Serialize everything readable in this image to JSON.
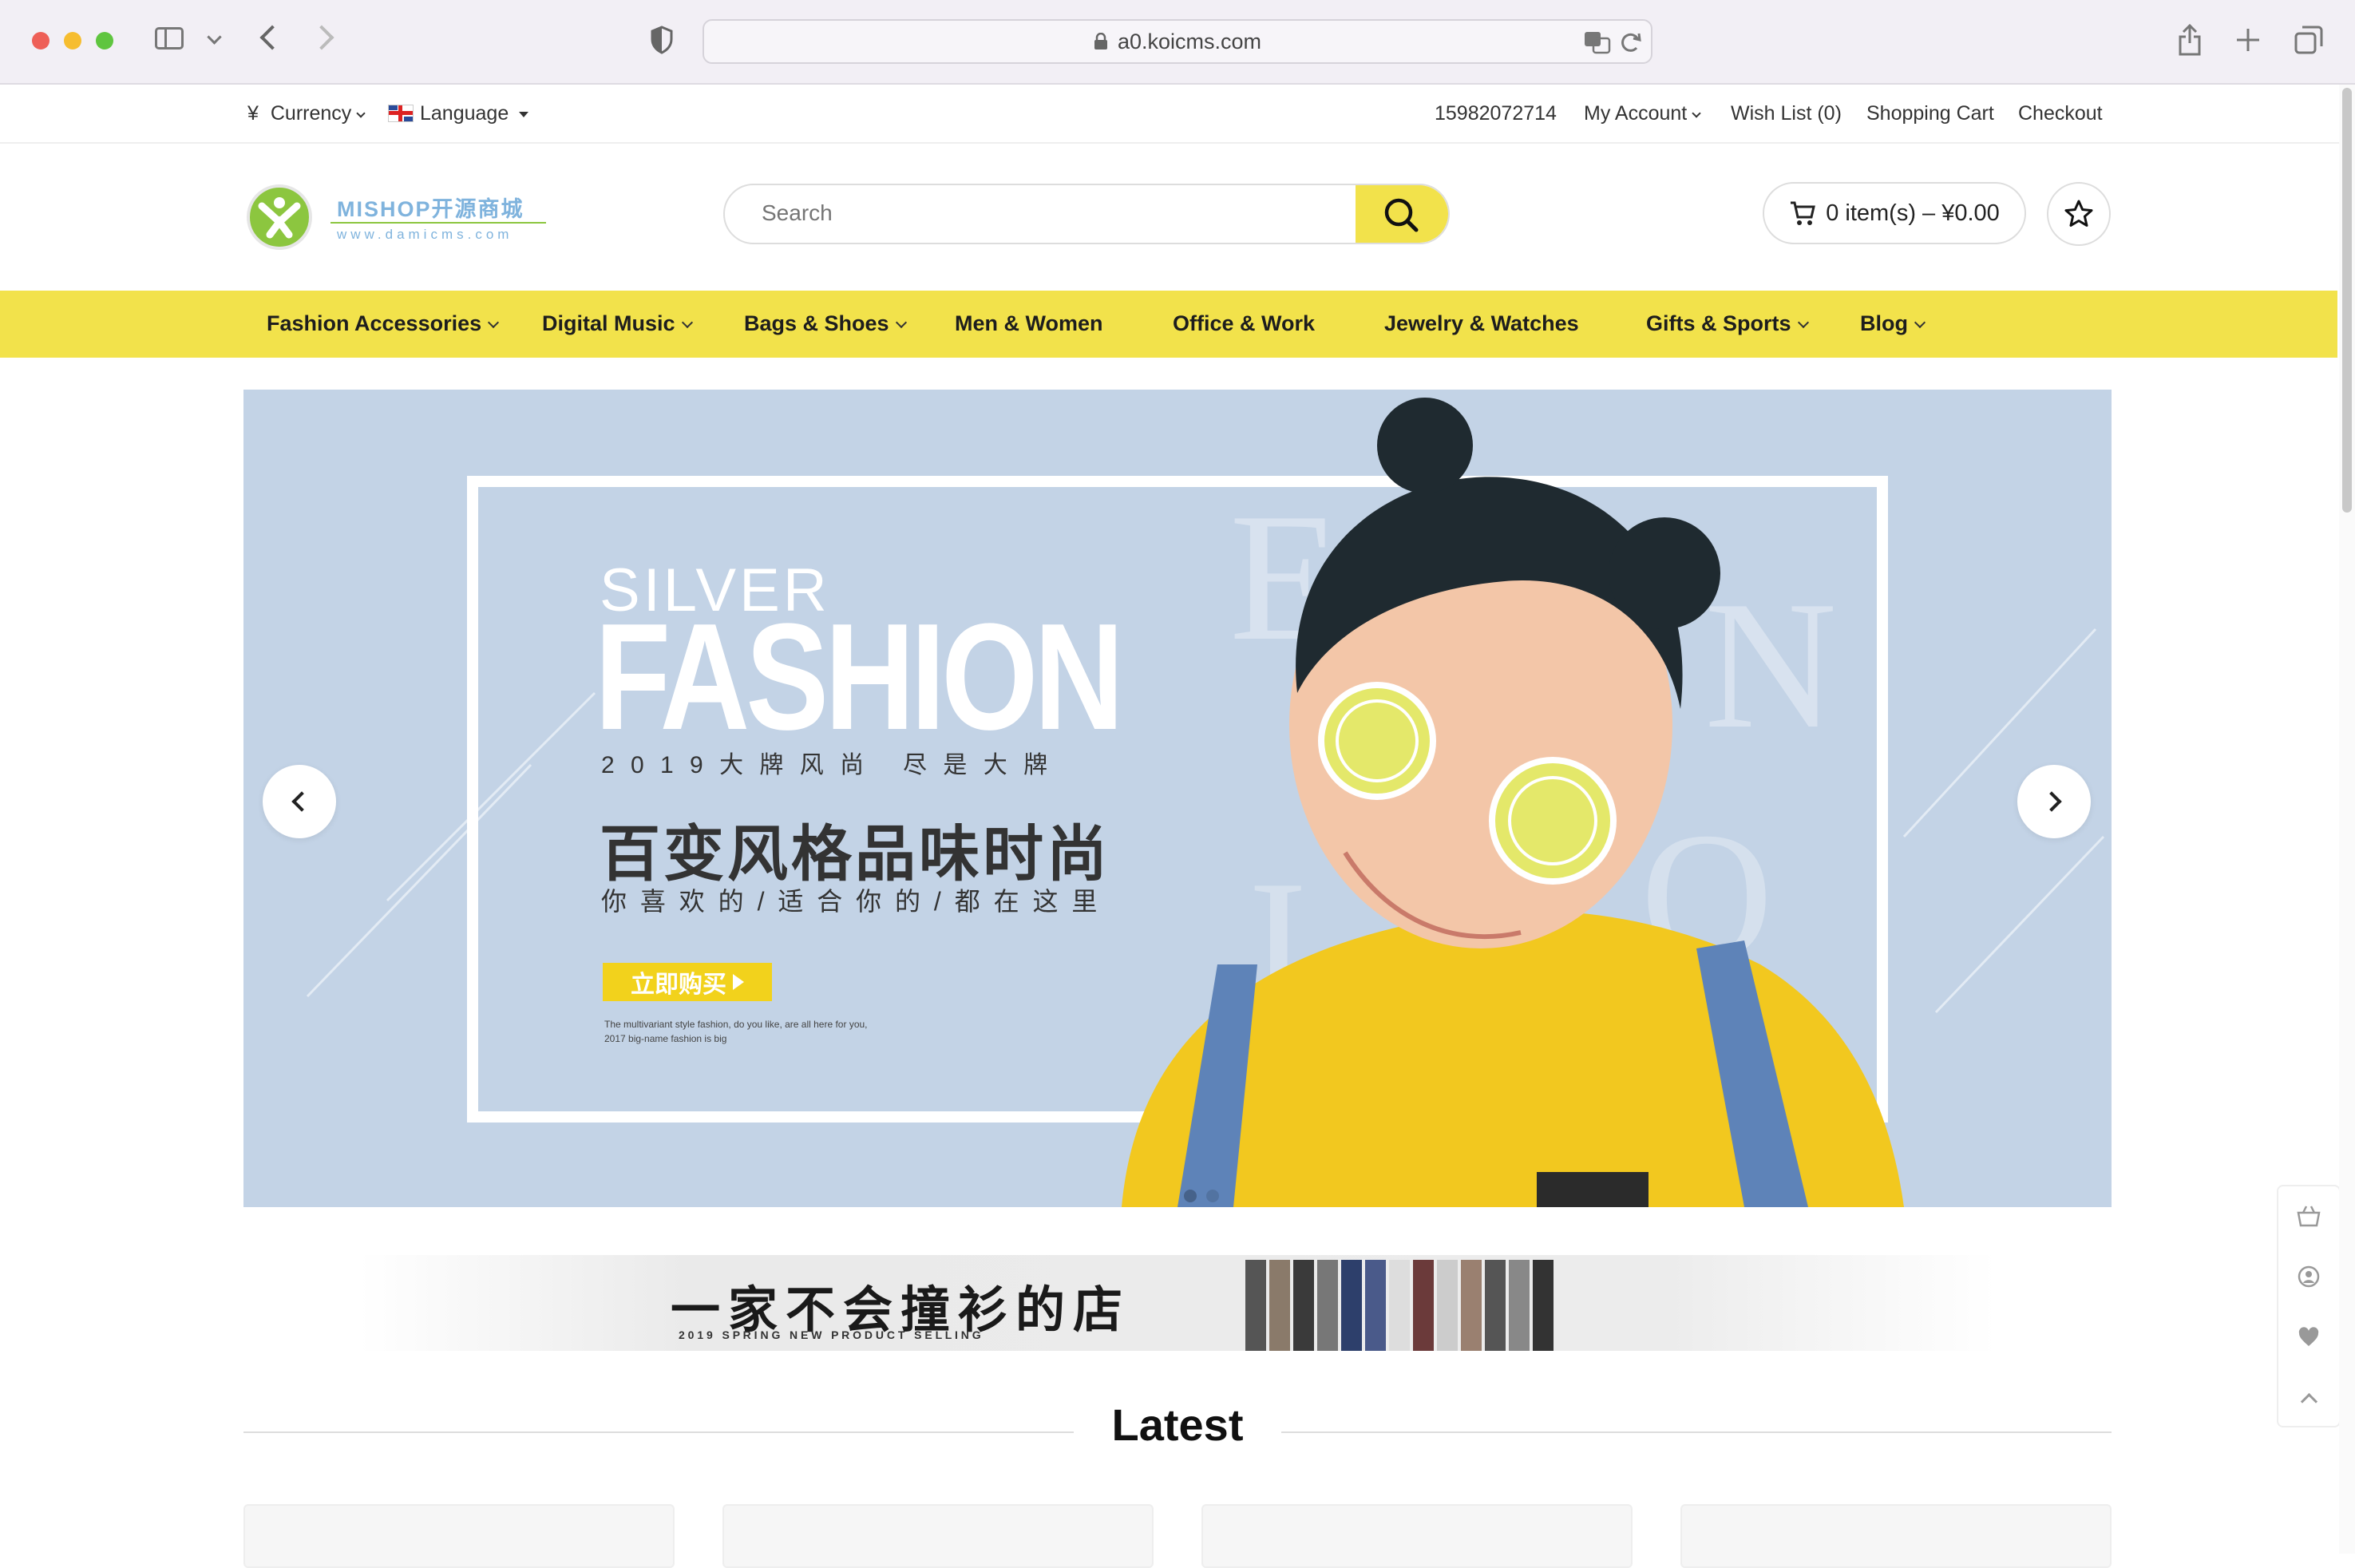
{
  "browser": {
    "url": "a0.koicms.com"
  },
  "topbar": {
    "currency_label": "Currency",
    "currency_symbol": "¥",
    "language_label": "Language",
    "phone": "15982072714",
    "my_account": "My Account",
    "wish_list": "Wish List (0)",
    "shopping_cart": "Shopping Cart",
    "checkout": "Checkout"
  },
  "header": {
    "logo_title": "MISHOP开源商城",
    "logo_subtitle": "www.damicms.com",
    "search_placeholder": "Search",
    "cart_summary": "0 item(s) – ¥0.00"
  },
  "nav": {
    "items": [
      {
        "label": "Fashion Accessories",
        "dropdown": true
      },
      {
        "label": "Digital Music",
        "dropdown": true
      },
      {
        "label": "Bags & Shoes",
        "dropdown": true
      },
      {
        "label": "Men & Women",
        "dropdown": false
      },
      {
        "label": "Office & Work",
        "dropdown": false
      },
      {
        "label": "Jewelry & Watches",
        "dropdown": false
      },
      {
        "label": "Gifts & Sports",
        "dropdown": true
      },
      {
        "label": "Blog",
        "dropdown": true
      }
    ]
  },
  "banner": {
    "line1": "SILVER",
    "line2": "FASHION",
    "line3": "2 0 1 9 大 牌 风 尚   尽 是 大 牌",
    "headline": "百变风格品味时尚",
    "subline": "你 喜 欢 的 / 适 合 你 的 / 都 在 这 里",
    "cta": "立即购买",
    "small1": "The multivariant style fashion, do you like, are all here for you,",
    "small2": "2017 big-name fashion is big",
    "letters": [
      "E",
      "N",
      "J",
      "O"
    ]
  },
  "promo": {
    "title": "一家不会撞衫的店",
    "subtitle": "2 0 1 9   S P R I N G   N E W   P R O D U C T   S E L L I N G"
  },
  "sections": {
    "latest_title": "Latest"
  },
  "colors": {
    "accent": "#f2e24b",
    "banner_bg": "#c3d3e6"
  }
}
